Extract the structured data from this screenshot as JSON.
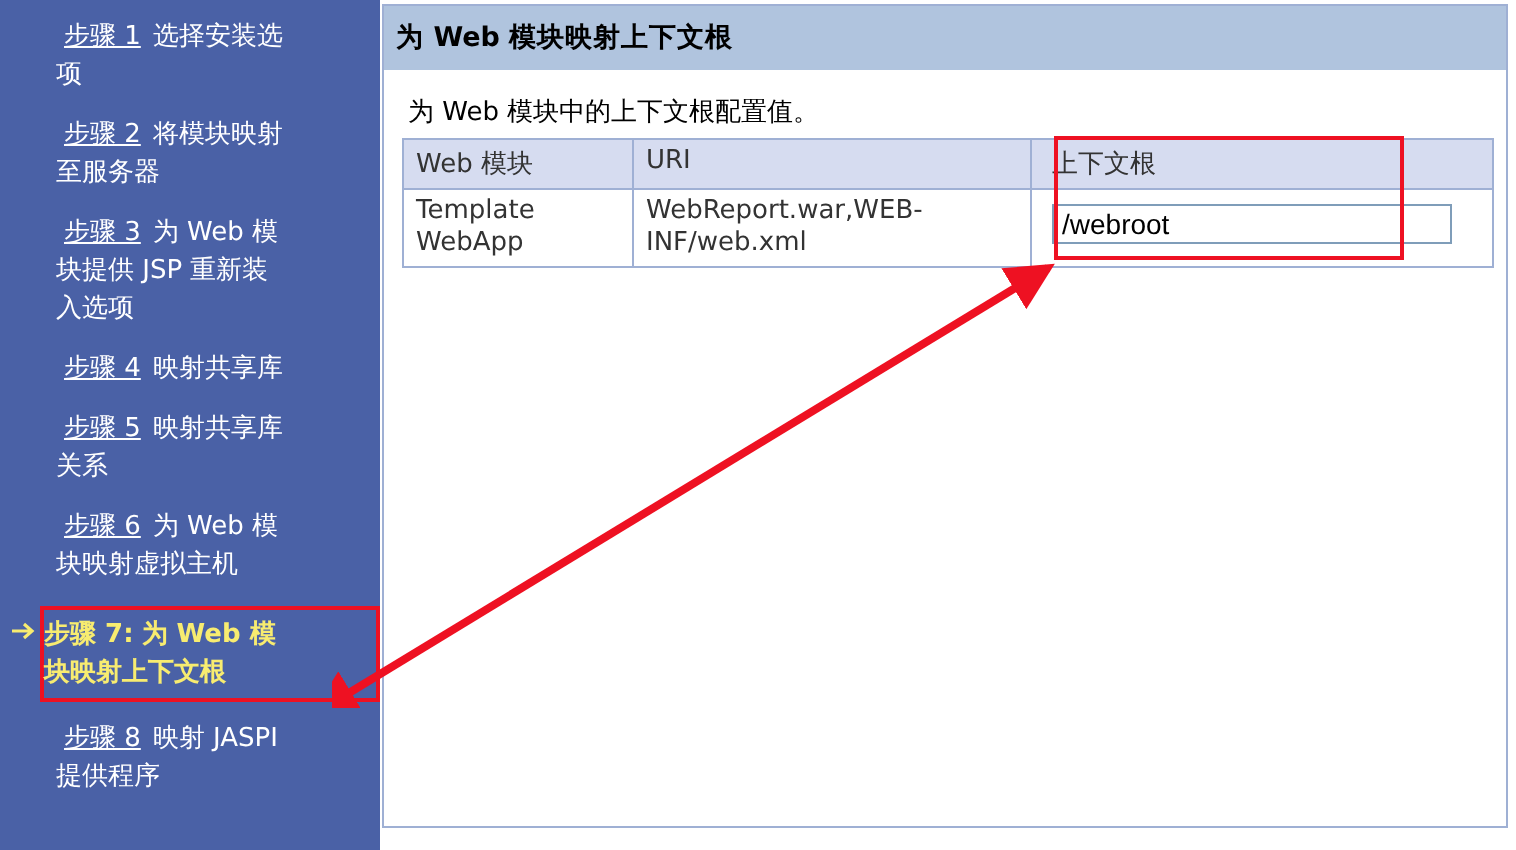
{
  "sidebar": {
    "items": [
      {
        "step": "步骤 1",
        "title": "选择安装选项",
        "selected": false
      },
      {
        "step": "步骤 2",
        "title": "将模块映射至服务器",
        "selected": false
      },
      {
        "step": "步骤 3",
        "title": "为 Web 模块提供 JSP 重新装入选项",
        "selected": false
      },
      {
        "step": "步骤 4",
        "title": "映射共享库",
        "selected": false
      },
      {
        "step": "步骤 5",
        "title": "映射共享库关系",
        "selected": false
      },
      {
        "step": "步骤 6",
        "title": "为 Web 模块映射虚拟主机",
        "selected": false
      },
      {
        "step": "步骤 7:",
        "title": "为 Web 模块映射上下文根",
        "selected": true
      },
      {
        "step": "步骤 8",
        "title": "映射 JASPI 提供程序",
        "selected": false
      }
    ]
  },
  "panel": {
    "title": "为 Web 模块映射上下文根",
    "description": "为 Web 模块中的上下文根配置值。",
    "table": {
      "columns": [
        "Web 模块",
        "URI",
        "上下文根"
      ],
      "rows": [
        {
          "module": "Template WebApp",
          "uri": "WebReport.war,WEB-INF/web.xml",
          "context_root": "/webroot"
        }
      ]
    }
  }
}
